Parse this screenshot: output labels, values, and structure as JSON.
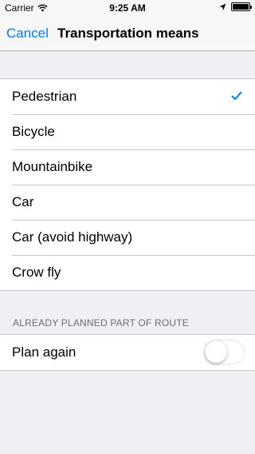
{
  "status_bar": {
    "carrier": "Carrier",
    "time": "9:25 AM",
    "icons": [
      "wifi-icon",
      "location-arrow-icon",
      "battery-icon"
    ]
  },
  "nav": {
    "cancel_label": "Cancel",
    "title": "Transportation means",
    "accent_color": "#007aff"
  },
  "means": {
    "items": [
      {
        "label": "Pedestrian",
        "selected": true
      },
      {
        "label": "Bicycle",
        "selected": false
      },
      {
        "label": "Mountainbike",
        "selected": false
      },
      {
        "label": "Car",
        "selected": false
      },
      {
        "label": "Car (avoid highway)",
        "selected": false
      },
      {
        "label": "Crow fly",
        "selected": false
      }
    ]
  },
  "replan": {
    "section_header": "ALREADY PLANNED PART OF ROUTE",
    "label": "Plan again",
    "toggle_on": false
  }
}
